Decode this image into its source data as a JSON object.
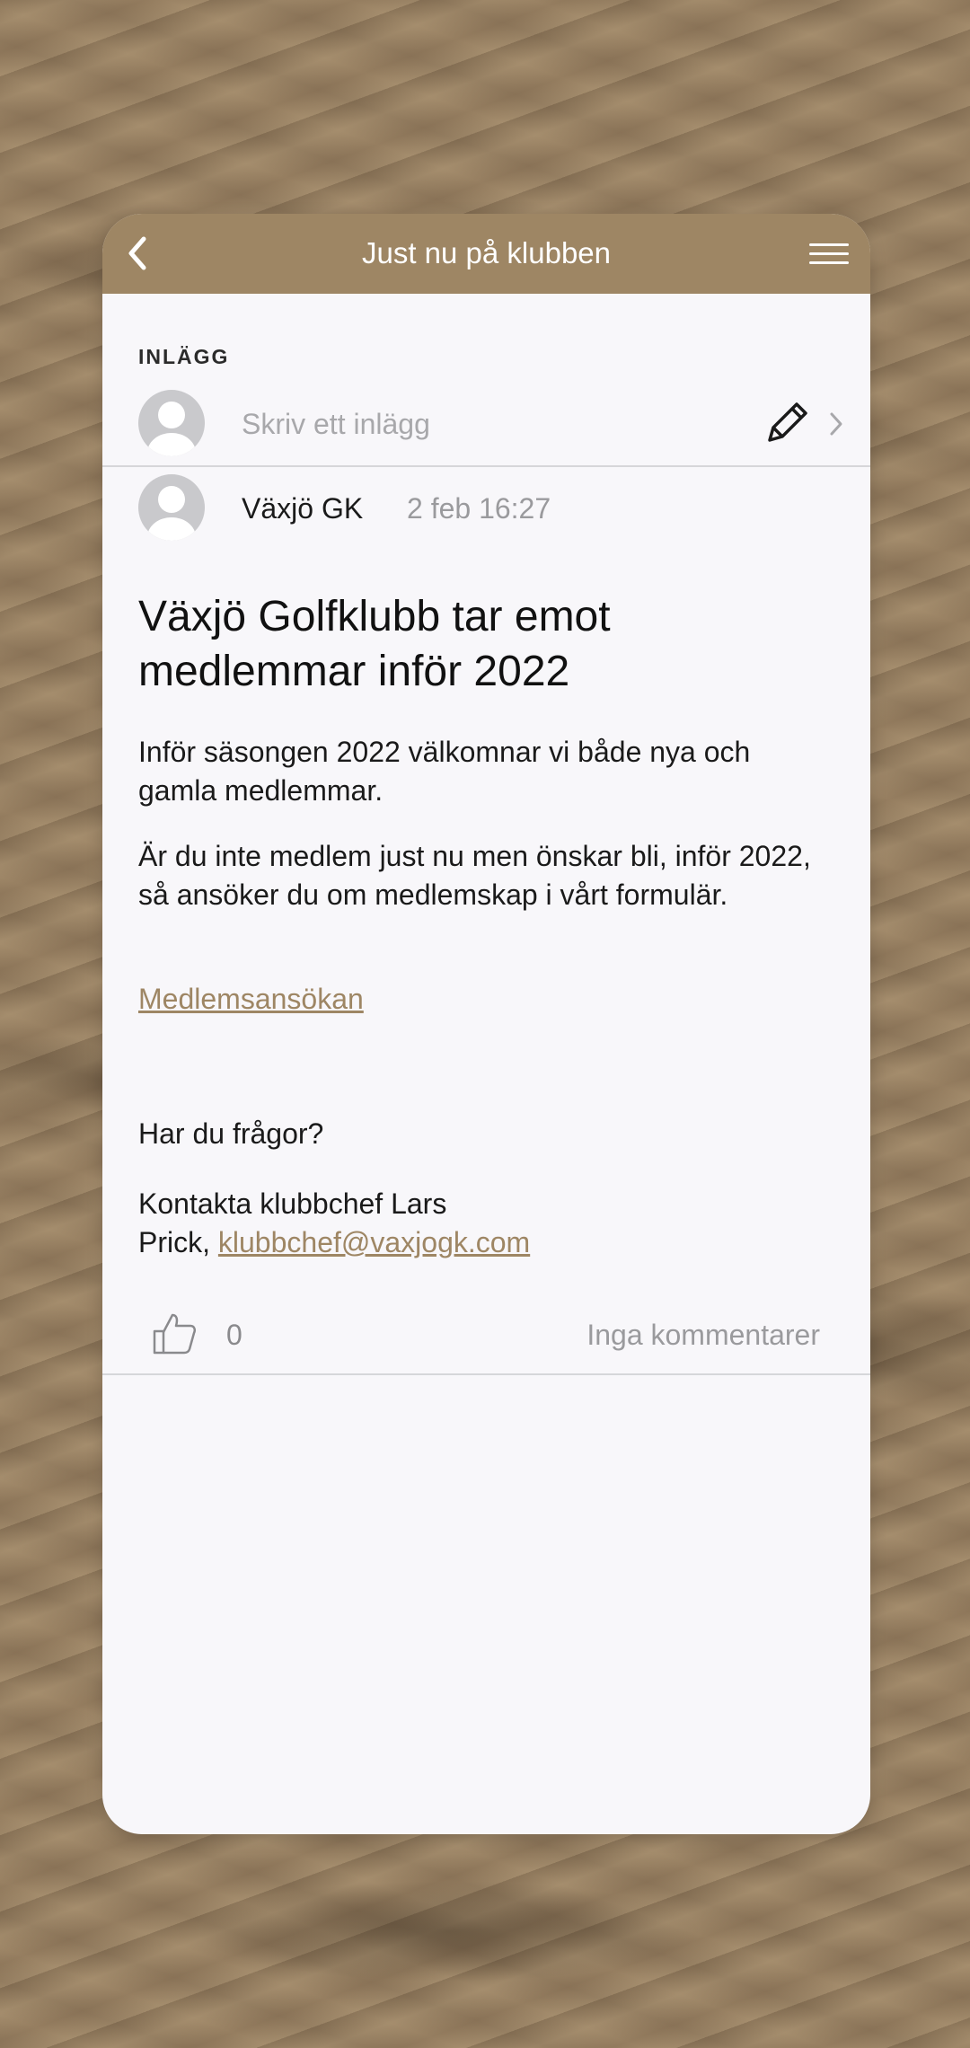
{
  "header": {
    "title": "Just nu på klubben",
    "back_icon": "chevron-left-icon",
    "menu_icon": "hamburger-menu-icon",
    "color": "#9e8664"
  },
  "compose": {
    "section_label": "INLÄGG",
    "placeholder": "Skriv ett inlägg",
    "edit_icon": "pencil-icon"
  },
  "post": {
    "author": "Växjö GK",
    "timestamp": "2 feb 16:27",
    "title": "Växjö Golfklubb tar emot medlemmar inför 2022",
    "paragraph_1": "Inför säsongen 2022 välkomnar vi både nya och gamla medlemmar.",
    "paragraph_2": "Är du inte medlem just nu men önskar bli, inför 2022, så ansöker du om medlemskap i vårt formulär.",
    "application_link": "Medlemsansökan",
    "question": "Har du frågor?",
    "contact_line_1": "Kontakta klubbchef Lars",
    "contact_line_2_prefix": "Prick, ",
    "contact_email": "klubbchef@vaxjogk.com",
    "likes": "0",
    "comments": "Inga kommentarer"
  },
  "colors": {
    "accent": "#9e8664",
    "card_background": "#f8f7fa"
  }
}
